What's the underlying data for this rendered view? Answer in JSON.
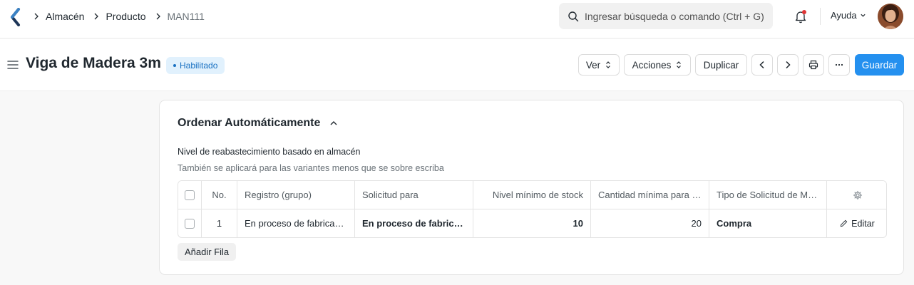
{
  "breadcrumbs": [
    "Almacén",
    "Producto",
    "MAN111"
  ],
  "search": {
    "placeholder": "Ingresar búsqueda o comando (Ctrl + G)"
  },
  "navbar": {
    "help_label": "Ayuda"
  },
  "page": {
    "title": "Viga de Madera 3m",
    "status": "Habilitado",
    "status_color": "#1971c2"
  },
  "toolbar": {
    "view_label": "Ver",
    "actions_label": "Acciones",
    "duplicate_label": "Duplicar",
    "save_label": "Guardar",
    "accent_color": "#2490ef"
  },
  "section": {
    "title": "Ordenar Automáticamente",
    "field_label": "Nivel de reabastecimiento basado en almacén",
    "field_description": "También se aplicará para las variantes menos que se sobre escriba"
  },
  "table": {
    "columns": [
      "No.",
      "Registro (grupo)",
      "Solicitud para",
      "Nivel mínimo de stock",
      "Cantidad mínima para reordenar",
      "Tipo de Solicitud de Material"
    ],
    "rows": [
      {
        "no": "1",
        "registro": "En proceso de fabricación - IP",
        "solicitud": "En proceso de fabricación - IP",
        "nivel": "10",
        "cantidad": "20",
        "tipo": "Compra",
        "edit_label": "Editar"
      }
    ],
    "add_row_label": "Añadir Fila"
  }
}
